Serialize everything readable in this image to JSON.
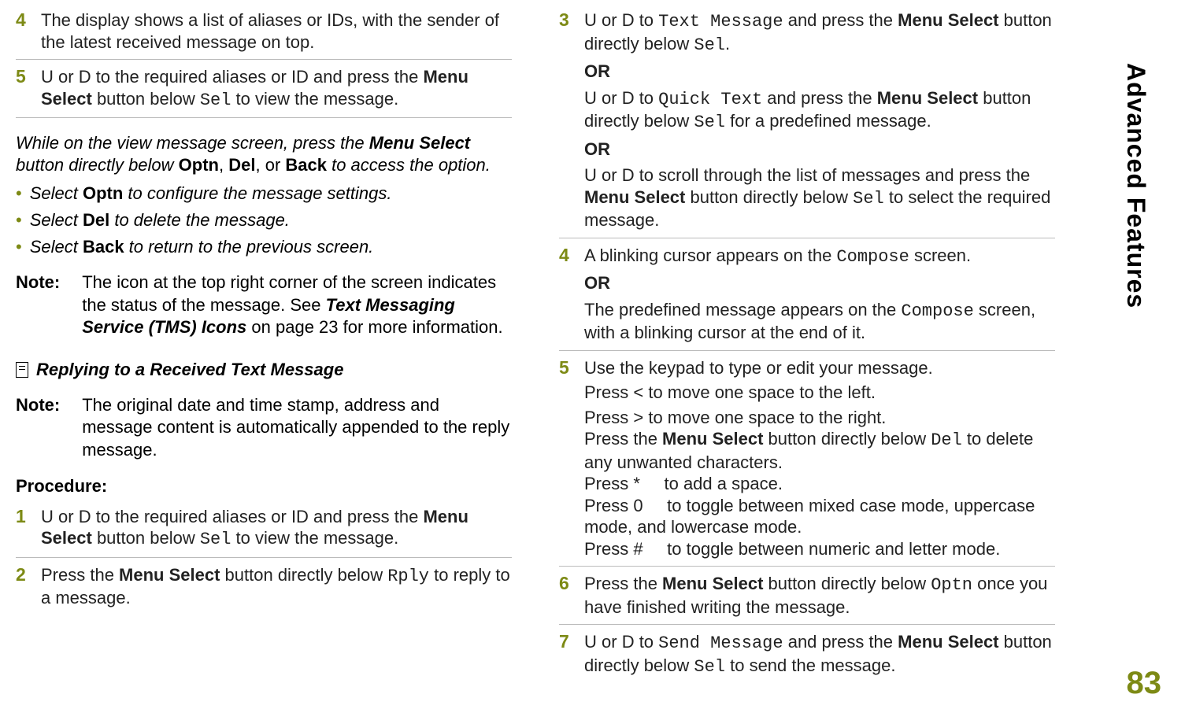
{
  "page_number": "83",
  "side_title": "Advanced Features",
  "left": {
    "step4": {
      "num": "4",
      "text": "The display shows a list of aliases or IDs, with the sender of the latest received message on top."
    },
    "step5": {
      "num": "5",
      "u": "U",
      "or1": " or ",
      "d": "D",
      "part1": " to the required aliases or ID and press the ",
      "menu_select": "Menu Select",
      "part2": " button below ",
      "sel": "Sel",
      "part3": " to view the message."
    },
    "view_para": {
      "p1": "While on the view message screen, press the ",
      "ms": "Menu Select",
      "p2": " button directly below ",
      "optn": "Optn",
      "c1": ", ",
      "del": "Del",
      "c2": ", or ",
      "back": "Back",
      "p3": " to access the option."
    },
    "bul1": {
      "p1": "Select ",
      "optn": "Optn",
      "p2": " to configure the message settings."
    },
    "bul2": {
      "p1": "Select ",
      "del": "Del",
      "p2": " to delete the message."
    },
    "bul3": {
      "p1": "Select ",
      "back": "Back",
      "p2": " to return to the previous screen."
    },
    "note1": {
      "label": "Note:",
      "p1": "The icon at the top right corner of the screen indicates the status of the message. See ",
      "tms": "Text Messaging Service (TMS) Icons",
      "p2": " on page 23 for more information."
    },
    "section_title": "Replying to a Received Text Message",
    "note2": {
      "label": "Note:",
      "text": "The original date and time stamp, address and message content is automatically appended to the reply message."
    },
    "procedure": "Procedure:",
    "proc1": {
      "num": "1",
      "u": "U",
      "or1": " or ",
      "d": "D",
      "p1": " to the required aliases or ID and press the ",
      "ms": "Menu Select",
      "p2": " button below ",
      "sel": "Sel",
      "p3": " to view the message."
    },
    "proc2": {
      "num": "2",
      "p1": "Press the ",
      "ms": "Menu Select",
      "p2": " button directly below ",
      "rply": "Rply",
      "p3": " to reply to a message."
    }
  },
  "right": {
    "step3": {
      "num": "3",
      "u": "U",
      "or1": " or ",
      "d": "D",
      "p1": " to ",
      "tm": "Text Message",
      "p2": " and press the ",
      "ms": "Menu Select",
      "p3": " button directly below ",
      "sel": "Sel",
      "p4": ".",
      "or_a": "OR",
      "u2": "U",
      "or2": " or ",
      "d2": "D",
      "p5": " to ",
      "qt": "Quick Text",
      "p6": " and press the ",
      "ms2": "Menu Select",
      "p7": " button directly below ",
      "sel2": "Sel",
      "p8": " for a predefined message.",
      "or_b": "OR",
      "u3": "U",
      "or3": " or ",
      "d3": "D",
      "p9": " to scroll through the list of messages and press the ",
      "ms3": "Menu Select",
      "p10": " button directly below ",
      "sel3": "Sel",
      "p11": " to select the required message."
    },
    "step4": {
      "num": "4",
      "p1": "A blinking cursor appears on the ",
      "comp": "Compose",
      "p2": " screen.",
      "or_a": "OR",
      "p3": "The predefined message appears on the ",
      "comp2": "Compose",
      "p4": " screen, with a blinking cursor at the end of it."
    },
    "step5": {
      "num": "5",
      "l1": "Use the keypad to type or edit your message.",
      "l2a": "Press ",
      "lt": "<",
      "l2b": " to move one space to the left.",
      "l3a": "Press ",
      "gt": ">",
      "l3b": " to move one space to the right.",
      "l4a": "Press the ",
      "ms": "Menu Select",
      "l4b": " button directly below ",
      "del": "Del",
      "l4c": " to delete any unwanted characters.",
      "l5a": "Press ",
      "star": "*",
      "l5b": " to add a space.",
      "l6a": "Press ",
      "zero": "0",
      "l6b": " to toggle between mixed case mode, uppercase mode, and lowercase mode.",
      "l7a": "Press ",
      "hash": "#",
      "l7b": " to toggle between numeric and letter mode."
    },
    "step6": {
      "num": "6",
      "p1": "Press the ",
      "ms": "Menu Select",
      "p2": " button directly below ",
      "optn": "Optn",
      "p3": " once you have finished writing the message."
    },
    "step7": {
      "num": "7",
      "u": "U",
      "or1": " or ",
      "d": "D",
      "p1": " to ",
      "sm": "Send Message",
      "p2": " and press the ",
      "ms": "Menu Select",
      "p3": " button directly below ",
      "sel": "Sel",
      "p4": " to send the message."
    }
  }
}
